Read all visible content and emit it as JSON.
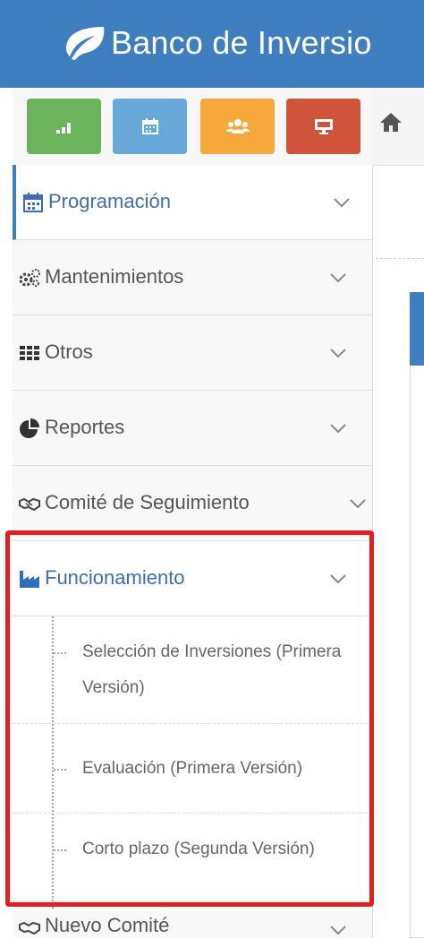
{
  "header": {
    "brand": "Banco de Inversio",
    "logo_icon": "leaf-icon",
    "color": "#3f7fc0"
  },
  "shortcuts": [
    {
      "icon": "chart-icon",
      "color": "#6bb45c"
    },
    {
      "icon": "calendar-icon",
      "color": "#69a9d9"
    },
    {
      "icon": "users-icon",
      "color": "#f7a83a"
    },
    {
      "icon": "monitor-icon",
      "color": "#d0533c"
    }
  ],
  "menu": {
    "programacion": "Programación",
    "mantenimientos": "Mantenimientos",
    "otros": "Otros",
    "reportes": "Reportes",
    "comite": "Comité de Seguimiento",
    "funcionamiento": "Funcionamiento",
    "nuevo_comite": "Nuevo Comité"
  },
  "submenu": {
    "item1": "Selección de Inversiones (Primera Versión)",
    "item2": "Evaluación (Primera Versión)",
    "item3": "Corto plazo (Segunda Versión)"
  },
  "highlight_color": "#e21e1e"
}
